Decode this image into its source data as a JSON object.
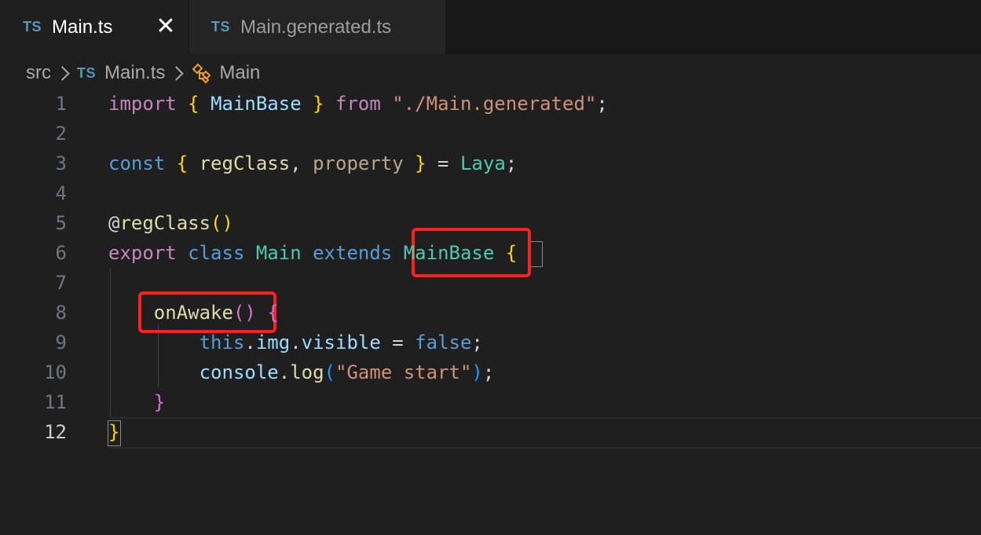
{
  "tabs": [
    {
      "icon": "TS",
      "label": "Main.ts",
      "close": "✕"
    },
    {
      "icon": "TS",
      "label": "Main.generated.ts"
    }
  ],
  "breadcrumb": {
    "folder": "src",
    "file_icon": "TS",
    "file": "Main.ts",
    "symbol": "Main"
  },
  "editor": {
    "line_numbers": [
      "1",
      "2",
      "3",
      "4",
      "5",
      "6",
      "7",
      "8",
      "9",
      "10",
      "11",
      "12"
    ],
    "lines": [
      [
        {
          "t": "import",
          "c": "kwc"
        },
        {
          "t": " ",
          "c": "punc"
        },
        {
          "t": "{",
          "c": "br1"
        },
        {
          "t": " ",
          "c": "punc"
        },
        {
          "t": "MainBase",
          "c": "var"
        },
        {
          "t": " ",
          "c": "punc"
        },
        {
          "t": "}",
          "c": "br1"
        },
        {
          "t": " ",
          "c": "punc"
        },
        {
          "t": "from",
          "c": "kwc"
        },
        {
          "t": " ",
          "c": "punc"
        },
        {
          "t": "\"./Main.generated\"",
          "c": "str"
        },
        {
          "t": ";",
          "c": "punc"
        }
      ],
      [],
      [
        {
          "t": "const",
          "c": "kw"
        },
        {
          "t": " ",
          "c": "punc"
        },
        {
          "t": "{",
          "c": "br1"
        },
        {
          "t": " ",
          "c": "punc"
        },
        {
          "t": "regClass",
          "c": "fn"
        },
        {
          "t": ", ",
          "c": "punc"
        },
        {
          "t": "property",
          "c": "dim"
        },
        {
          "t": " ",
          "c": "punc"
        },
        {
          "t": "}",
          "c": "br1"
        },
        {
          "t": " = ",
          "c": "punc"
        },
        {
          "t": "Laya",
          "c": "cls"
        },
        {
          "t": ";",
          "c": "punc"
        }
      ],
      [],
      [
        {
          "t": "@",
          "c": "punc"
        },
        {
          "t": "regClass",
          "c": "fn"
        },
        {
          "t": "()",
          "c": "br1"
        }
      ],
      [
        {
          "t": "export",
          "c": "kwc"
        },
        {
          "t": " ",
          "c": "punc"
        },
        {
          "t": "class",
          "c": "kw"
        },
        {
          "t": " ",
          "c": "punc"
        },
        {
          "t": "Main",
          "c": "cls"
        },
        {
          "t": " ",
          "c": "punc"
        },
        {
          "t": "extends",
          "c": "kw"
        },
        {
          "t": " ",
          "c": "punc"
        },
        {
          "t": "MainBase",
          "c": "cls"
        },
        {
          "t": " ",
          "c": "punc"
        },
        {
          "t": "{",
          "c": "br1"
        }
      ],
      [],
      [
        {
          "t": "    ",
          "c": "punc"
        },
        {
          "t": "onAwake",
          "c": "fn"
        },
        {
          "t": "()",
          "c": "br2"
        },
        {
          "t": " ",
          "c": "punc"
        },
        {
          "t": "{",
          "c": "br2"
        }
      ],
      [
        {
          "t": "        ",
          "c": "punc"
        },
        {
          "t": "this",
          "c": "kw"
        },
        {
          "t": ".",
          "c": "punc"
        },
        {
          "t": "img",
          "c": "var"
        },
        {
          "t": ".",
          "c": "punc"
        },
        {
          "t": "visible",
          "c": "var"
        },
        {
          "t": " = ",
          "c": "punc"
        },
        {
          "t": "false",
          "c": "kw"
        },
        {
          "t": ";",
          "c": "punc"
        }
      ],
      [
        {
          "t": "        ",
          "c": "punc"
        },
        {
          "t": "console",
          "c": "var"
        },
        {
          "t": ".",
          "c": "punc"
        },
        {
          "t": "log",
          "c": "fn"
        },
        {
          "t": "(",
          "c": "br3"
        },
        {
          "t": "\"Game start\"",
          "c": "str"
        },
        {
          "t": ")",
          "c": "br3"
        },
        {
          "t": ";",
          "c": "punc"
        }
      ],
      [
        {
          "t": "    ",
          "c": "punc"
        },
        {
          "t": "}",
          "c": "br2"
        }
      ],
      [
        {
          "t": "}",
          "c": "br1"
        }
      ]
    ]
  }
}
